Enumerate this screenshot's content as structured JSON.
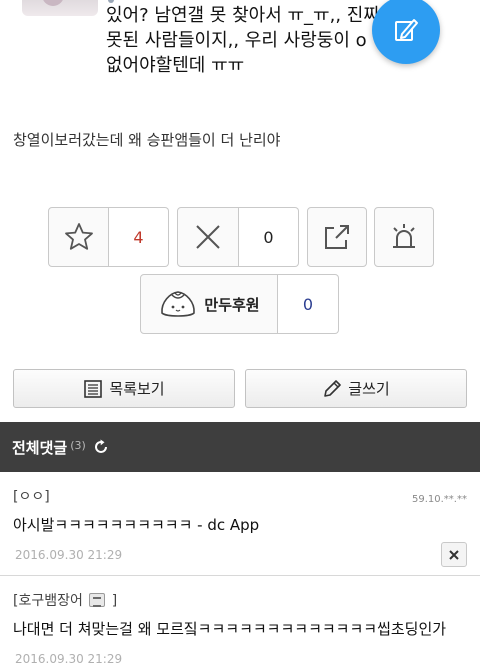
{
  "quote": {
    "lines": [
      "있어? 남연갤 못 찾아서 ㅠ_ㅠ,, 진짜",
      "못된 사람들이지,, 우리 사랑둥이 o",
      "없어야할텐데 ㅠㅠ"
    ]
  },
  "post": {
    "text": "창열이보러갔는데 왜 승판앰들이 더 난리야"
  },
  "reactions": {
    "recommend_count": "4",
    "notrecommend_count": "0",
    "donation_label": "만두후원",
    "donation_count": "0"
  },
  "actions": {
    "list_label": "목록보기",
    "write_label": "글쓰기"
  },
  "comments": {
    "title": "전체댓글",
    "count": "(3)",
    "items": [
      {
        "author": "[ㅇㅇ]",
        "ip": "59.10.**.**",
        "body": "아시발ㅋㅋㅋㅋㅋㅋㅋㅋㅋㅋ - dc App",
        "date": "2016.09.30 21:29"
      },
      {
        "author": "[호구뱀장어",
        "author_suffix": "]",
        "body": "나대면 더 쳐맞는걸 왜 모르짘ㅋㅋㅋㅋㅋㅋㅋㅋㅋㅋㅋㅋㅋ씹초딩인가",
        "date": "2016.09.30 21:29"
      }
    ]
  },
  "colors": {
    "fab": "#2d9df2",
    "recommend_count": "#c0392b",
    "donation_count": "#2c3e91",
    "header_bg": "#3e3e3e"
  }
}
